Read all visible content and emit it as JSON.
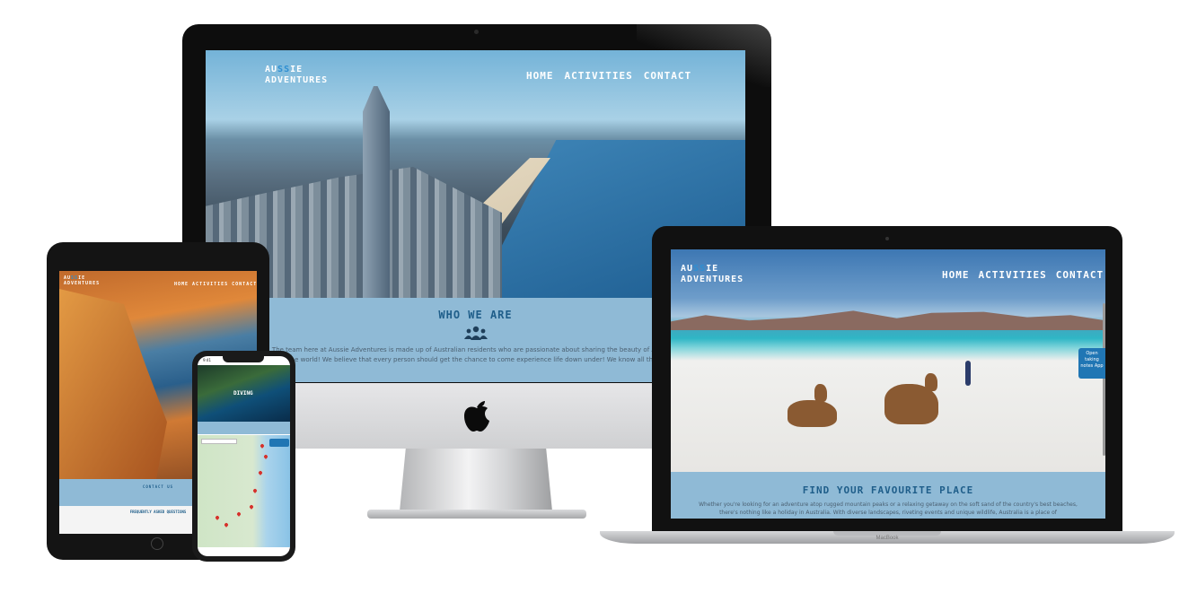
{
  "site": {
    "logo_line1_a": "AU",
    "logo_line1_hl": "SS",
    "logo_line1_b": "IE",
    "logo_line2": "ADVENTURES",
    "nav": [
      "HOME",
      "ACTIVITIES",
      "CONTACT"
    ]
  },
  "imac": {
    "section_title": "WHO WE ARE",
    "section_icon": "users-icon",
    "section_text_line1": "The team here at Aussie Adventures is made up of Australian residents who are passionate about sharing the beauty of Australi",
    "section_text_line2": "the world! We believe that every person should get the chance to come experience life down under! We know all the b"
  },
  "macbook": {
    "section_title": "FIND YOUR FAVOURITE PLACE",
    "section_text": "Whether you're looking for an adventure atop rugged mountain peaks or a relaxing getaway on the soft sand of the country's best beaches, there's nothing like a holiday in Australia. With diverse landscapes, riveting events and unique wildlife, Australia is a place of",
    "side_button": "Open taking notes App",
    "brand_label": "MacBook"
  },
  "ipad": {
    "section_title": "CONTACT US",
    "sub_title": "FREQUENTLY ASKED QUESTIONS"
  },
  "iphone": {
    "status_time": "9:41",
    "hero_title": "DIVING"
  },
  "colors": {
    "band": "#8fbad6",
    "heading": "#1f5e8a",
    "logo_highlight": "#2f8fd2"
  }
}
